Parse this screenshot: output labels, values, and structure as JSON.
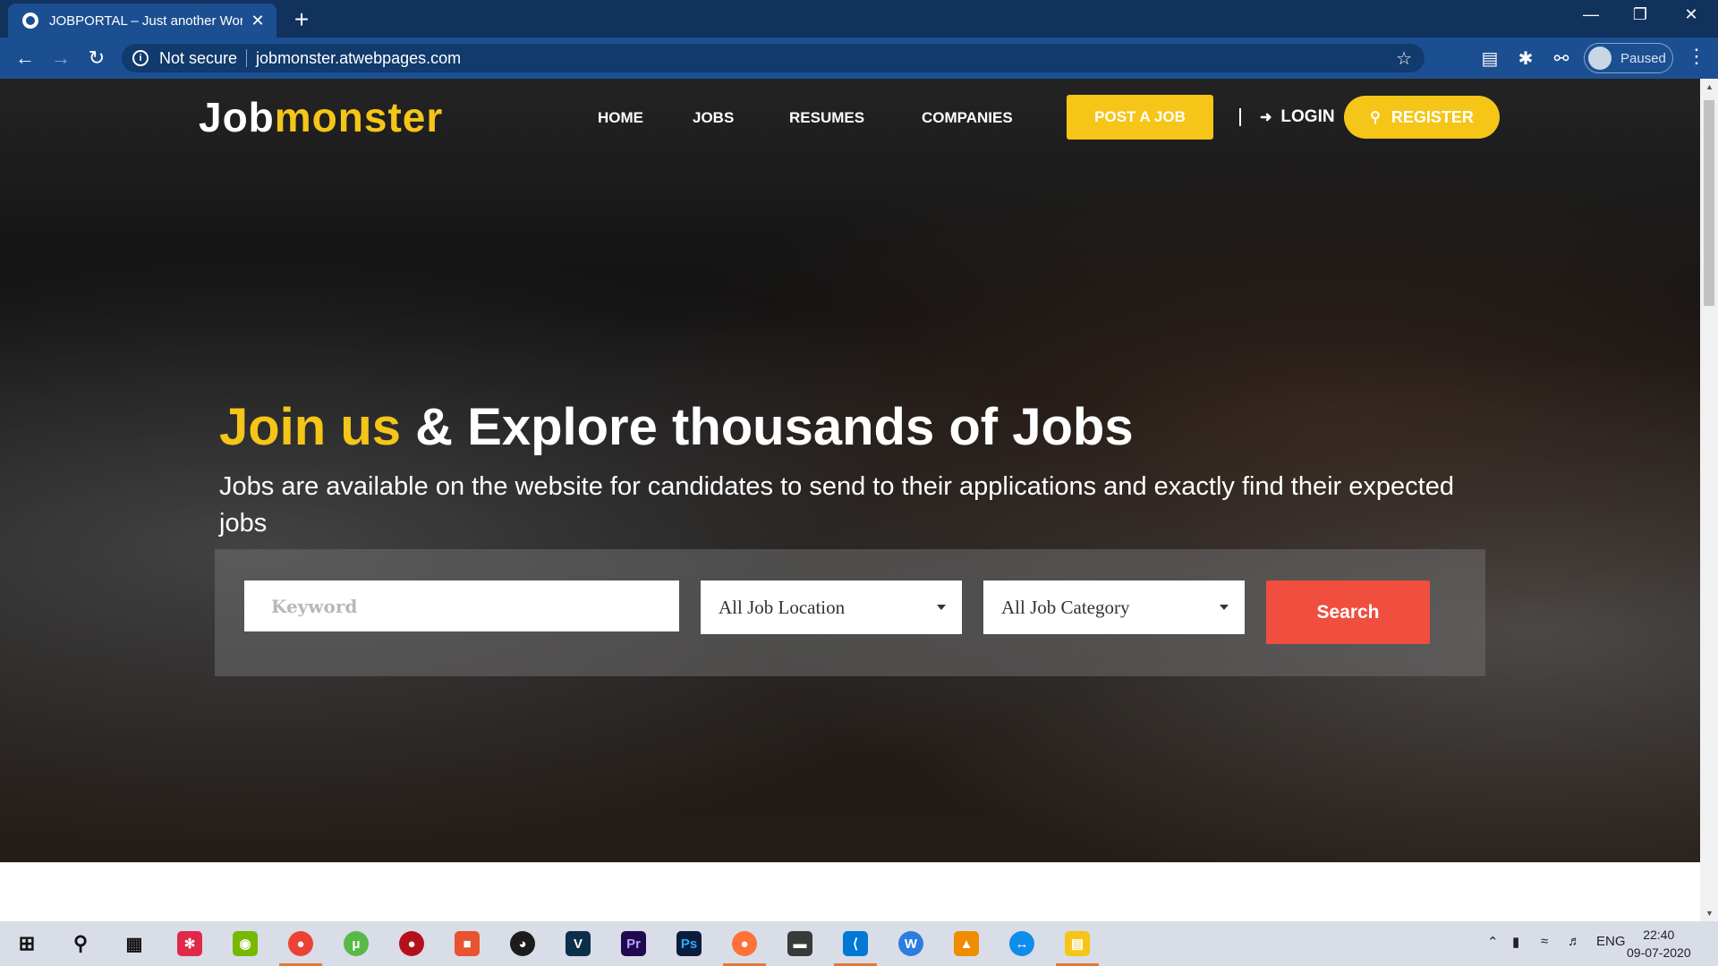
{
  "browser": {
    "tab_title": "JOBPORTAL – Just another Wordi",
    "tab_close": "✕",
    "new_tab": "+",
    "security_label": "Not secure",
    "url": "jobmonster.atwebpages.com",
    "profile_status": "Paused",
    "icons": [
      "back-icon",
      "forward-icon",
      "reload-icon",
      "info-icon",
      "star-icon",
      "extension-icon",
      "puzzle-icon",
      "key-icon",
      "menu-icon"
    ]
  },
  "site": {
    "logo_part1": "Job",
    "logo_part2": "monster",
    "nav": [
      "HOME",
      "JOBS",
      "RESUMES",
      "COMPANIES"
    ],
    "post_job": "POST A JOB",
    "login": "LOGIN",
    "register": "REGISTER",
    "headline_accent": "Join us",
    "headline_rest": " & Explore thousands of Jobs",
    "subhead": "Jobs are available on the website for candidates to send to their applications and exactly find their expected jobs",
    "search": {
      "keyword_placeholder": "Keyword",
      "location": "All Job Location",
      "category": "All Job Category",
      "button": "Search"
    },
    "colors": {
      "accent": "#f5c518",
      "search_button": "#f04e3e"
    }
  },
  "taskbar": {
    "apps": [
      "windows-start",
      "search",
      "task-view",
      "app-red",
      "nvidia",
      "chrome",
      "utorrent",
      "app-dark-red",
      "app-box",
      "speedometer",
      "app-v",
      "premiere",
      "photoshop",
      "firefox",
      "app-dark",
      "vscode",
      "app-w",
      "vlc",
      "teamviewer",
      "file-explorer"
    ],
    "lang": "ENG",
    "time": "22:40",
    "date": "09-07-2020"
  }
}
